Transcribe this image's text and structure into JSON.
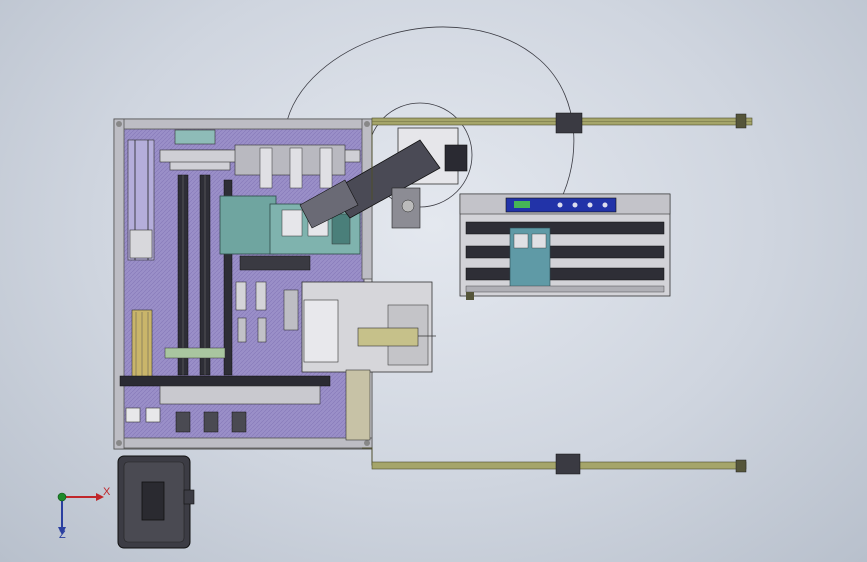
{
  "viewport": {
    "background_top": "#e4e8ef",
    "background_bottom": "#b8c0cc"
  },
  "colors": {
    "frame_purple": "#9a8fc8",
    "frame_purple_dark": "#7a6eae",
    "plate_teal": "#6fa5a0",
    "rail_olive": "#8a8a55",
    "metal_gray": "#c8c8cc",
    "dark_steel": "#3a3a42",
    "display_blue": "#2233a8"
  },
  "triad": {
    "x_label": "X",
    "y_label": "",
    "z_label": "Z",
    "x_color": "#c0262a",
    "y_color": "#1d8a2a",
    "z_color": "#2a3fa0"
  }
}
